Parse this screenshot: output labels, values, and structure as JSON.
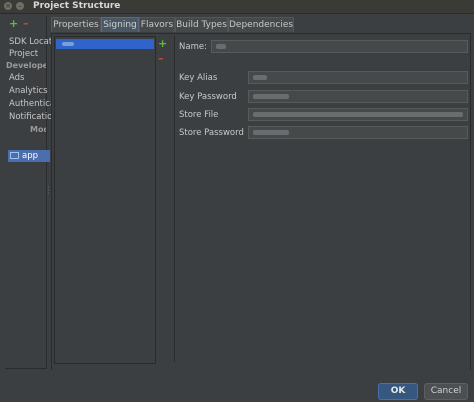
{
  "window": {
    "title": "Project Structure",
    "close_glyph": "×",
    "minimize_glyph": "–"
  },
  "left_toolbar": {
    "add_icon": "+",
    "remove_icon": "–"
  },
  "sidebar": {
    "items": [
      {
        "label": "SDK Location"
      },
      {
        "label": "Project"
      }
    ],
    "section_developer": "Developer Services",
    "services": [
      {
        "label": "Ads"
      },
      {
        "label": "Analytics"
      },
      {
        "label": "Authentication"
      },
      {
        "label": "Notifications"
      }
    ],
    "section_modules": "Modules",
    "module": {
      "label": "app"
    }
  },
  "tabs": [
    {
      "label": "Properties"
    },
    {
      "label": "Signing"
    },
    {
      "label": "Flavors"
    },
    {
      "label": "Build Types"
    },
    {
      "label": "Dependencies"
    }
  ],
  "signing_list": {
    "add_icon": "+",
    "remove_icon": "–"
  },
  "detail": {
    "name_label": "Name:",
    "key_alias_label": "Key Alias",
    "key_password_label": "Key Password",
    "store_file_label": "Store File",
    "store_password_label": "Store Password"
  },
  "buttons": {
    "ok": "OK",
    "cancel": "Cancel"
  },
  "colors": {
    "selection": "#2f65ca",
    "add_green": "#5bbf3a",
    "remove_red": "#d0473a",
    "ok_button": "#365880"
  }
}
